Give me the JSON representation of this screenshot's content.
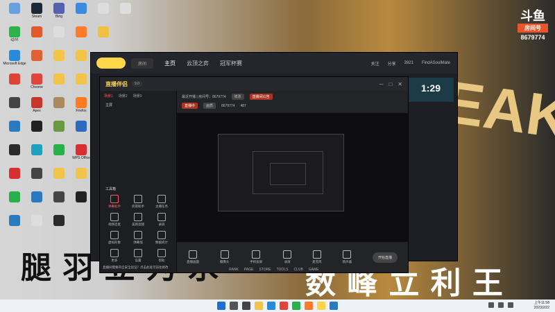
{
  "desktop": {
    "icons": [
      {
        "label": "",
        "color": "#6aa0e0",
        "col": 0,
        "row": 0
      },
      {
        "label": "Steam",
        "color": "#1b2838",
        "col": 1,
        "row": 0
      },
      {
        "label": "Bing",
        "color": "#5560b0",
        "col": 2,
        "row": 0
      },
      {
        "label": "",
        "color": "#3a8be0",
        "col": 3,
        "row": 0
      },
      {
        "label": "",
        "color": "#ddd",
        "col": 4,
        "row": 0
      },
      {
        "label": "",
        "color": "#ddd",
        "col": 5,
        "row": 0
      },
      {
        "label": "iQIYI",
        "color": "#2cb34a",
        "col": 0,
        "row": 1
      },
      {
        "label": "",
        "color": "#e05a2a",
        "col": 1,
        "row": 1
      },
      {
        "label": "",
        "color": "#ddd",
        "col": 2,
        "row": 1
      },
      {
        "label": "",
        "color": "#ff7b2a",
        "col": 3,
        "row": 1
      },
      {
        "label": "",
        "color": "#f0c040",
        "col": 4,
        "row": 1
      },
      {
        "label": "Microsoft Edge",
        "color": "#2a8ad8",
        "col": 0,
        "row": 2
      },
      {
        "label": "",
        "color": "#e06030",
        "col": 1,
        "row": 2
      },
      {
        "label": "",
        "color": "#f2c44a",
        "col": 2,
        "row": 2
      },
      {
        "label": "",
        "color": "#f2c44a",
        "col": 3,
        "row": 2
      },
      {
        "label": "",
        "color": "#d43",
        "col": 0,
        "row": 3
      },
      {
        "label": "Chrome",
        "color": "#e0453a",
        "col": 1,
        "row": 3
      },
      {
        "label": "",
        "color": "#f2c44a",
        "col": 2,
        "row": 3
      },
      {
        "label": "",
        "color": "#f2c44a",
        "col": 3,
        "row": 3
      },
      {
        "label": "",
        "color": "#444",
        "col": 0,
        "row": 4
      },
      {
        "label": "Apex",
        "color": "#c8352a",
        "col": 1,
        "row": 4
      },
      {
        "label": "",
        "color": "#aa8860",
        "col": 2,
        "row": 4
      },
      {
        "label": "Firefox",
        "color": "#ff7a20",
        "col": 3,
        "row": 4
      },
      {
        "label": "",
        "color": "#2a7ac0",
        "col": 0,
        "row": 5
      },
      {
        "label": "",
        "color": "#222",
        "col": 1,
        "row": 5
      },
      {
        "label": "",
        "color": "#6a9a40",
        "col": 2,
        "row": 5
      },
      {
        "label": "",
        "color": "#2a6ac0",
        "col": 3,
        "row": 5
      },
      {
        "label": "",
        "color": "#2a2a2a",
        "col": 0,
        "row": 6
      },
      {
        "label": "",
        "color": "#20a0c0",
        "col": 1,
        "row": 6
      },
      {
        "label": "",
        "color": "#2ab04a",
        "col": 2,
        "row": 6
      },
      {
        "label": "WPS Office",
        "color": "#d83030",
        "col": 3,
        "row": 6
      },
      {
        "label": "",
        "color": "#d83030",
        "col": 0,
        "row": 7
      },
      {
        "label": "",
        "color": "#444",
        "col": 1,
        "row": 7
      },
      {
        "label": "",
        "color": "#f2c44a",
        "col": 2,
        "row": 7
      },
      {
        "label": "",
        "color": "#f2c44a",
        "col": 3,
        "row": 7
      },
      {
        "label": "",
        "color": "#2ab04a",
        "col": 0,
        "row": 8
      },
      {
        "label": "",
        "color": "#2a7ac0",
        "col": 1,
        "row": 8
      },
      {
        "label": "",
        "color": "#444",
        "col": 2,
        "row": 8
      },
      {
        "label": "",
        "color": "#222",
        "col": 3,
        "row": 8
      },
      {
        "label": "",
        "color": "#2a7ac0",
        "col": 0,
        "row": 9
      },
      {
        "label": "",
        "color": "#ddd",
        "col": 1,
        "row": 9
      },
      {
        "label": "",
        "color": "#2a2a2a",
        "col": 2,
        "row": 9
      }
    ]
  },
  "wallpaper": {
    "big_text_left": "腿  羽  立  为  氷",
    "big_text_right": "数 峰 立 利 王",
    "right_word": "EAK"
  },
  "brand_badge": {
    "logo": "斗鱼",
    "tag": "房间号",
    "room": "8679774"
  },
  "app_window": {
    "room_label": "房间",
    "nav": [
      "主页",
      "云顶之弈",
      "冠军杯赛"
    ],
    "right_items": [
      "关注",
      "分享",
      "3921"
    ],
    "user": "FindASoulMate"
  },
  "stream_window": {
    "brand": "直播伴侣",
    "version": "9.0",
    "window_controls": [
      "─",
      "□",
      "✕"
    ],
    "scenes": [
      "场景1",
      "场景2",
      "场景3"
    ],
    "active_scene_index": 0,
    "source_label": "主屏",
    "tools_header": "工具箱",
    "tools": [
      {
        "label": "弹幕助手",
        "hot": true
      },
      {
        "label": "房管助手",
        "hot": false
      },
      {
        "label": "主播任务",
        "hot": false
      },
      {
        "label": "视频连麦",
        "hot": false
      },
      {
        "label": "美颜滤镜",
        "hot": false
      },
      {
        "label": "录屏",
        "hot": false
      },
      {
        "label": "虚拟形象",
        "hot": false
      },
      {
        "label": "弹幕墙",
        "hot": false
      },
      {
        "label": "数据统计",
        "hot": false
      },
      {
        "label": "更多",
        "hot": false
      },
      {
        "label": "设置",
        "hot": false
      },
      {
        "label": "帮助",
        "hot": false
      }
    ],
    "info_row1": {
      "title": "最近开播 | 房间号：8679774",
      "tag": "修改",
      "link": "直播间公告"
    },
    "info_row2": {
      "pill1": "直播中",
      "pill2": "画质",
      "text": "8679774",
      "count": "487"
    },
    "bottom_buttons": [
      "直播画面",
      "摄像头",
      "手机投屏",
      "录屏",
      "麦克风",
      "扬声器"
    ],
    "start_button": "开始直播",
    "notice": "直播间需要开启安全验证？点击此处可前往修改"
  },
  "live_time": "1:29",
  "foot_nav": [
    "RANK",
    "PAGE",
    "STORE",
    "TOOLS",
    "CLUB",
    "GAME"
  ],
  "taskbar": {
    "apps": [
      {
        "name": "start-button",
        "color": "#1e6fd0"
      },
      {
        "name": "search",
        "color": "#555"
      },
      {
        "name": "task-view",
        "color": "#444"
      },
      {
        "name": "file-explorer",
        "color": "#f2c44a"
      },
      {
        "name": "edge",
        "color": "#2a8ad8"
      },
      {
        "name": "chrome",
        "color": "#e0453a"
      },
      {
        "name": "wechat",
        "color": "#2ab04a"
      },
      {
        "name": "douyu",
        "color": "#ff7b2a"
      },
      {
        "name": "live-companion",
        "color": "#ffd54a"
      },
      {
        "name": "qq",
        "color": "#2a7ac0"
      }
    ],
    "time": "上午11:58",
    "date": "2023/2/22"
  }
}
